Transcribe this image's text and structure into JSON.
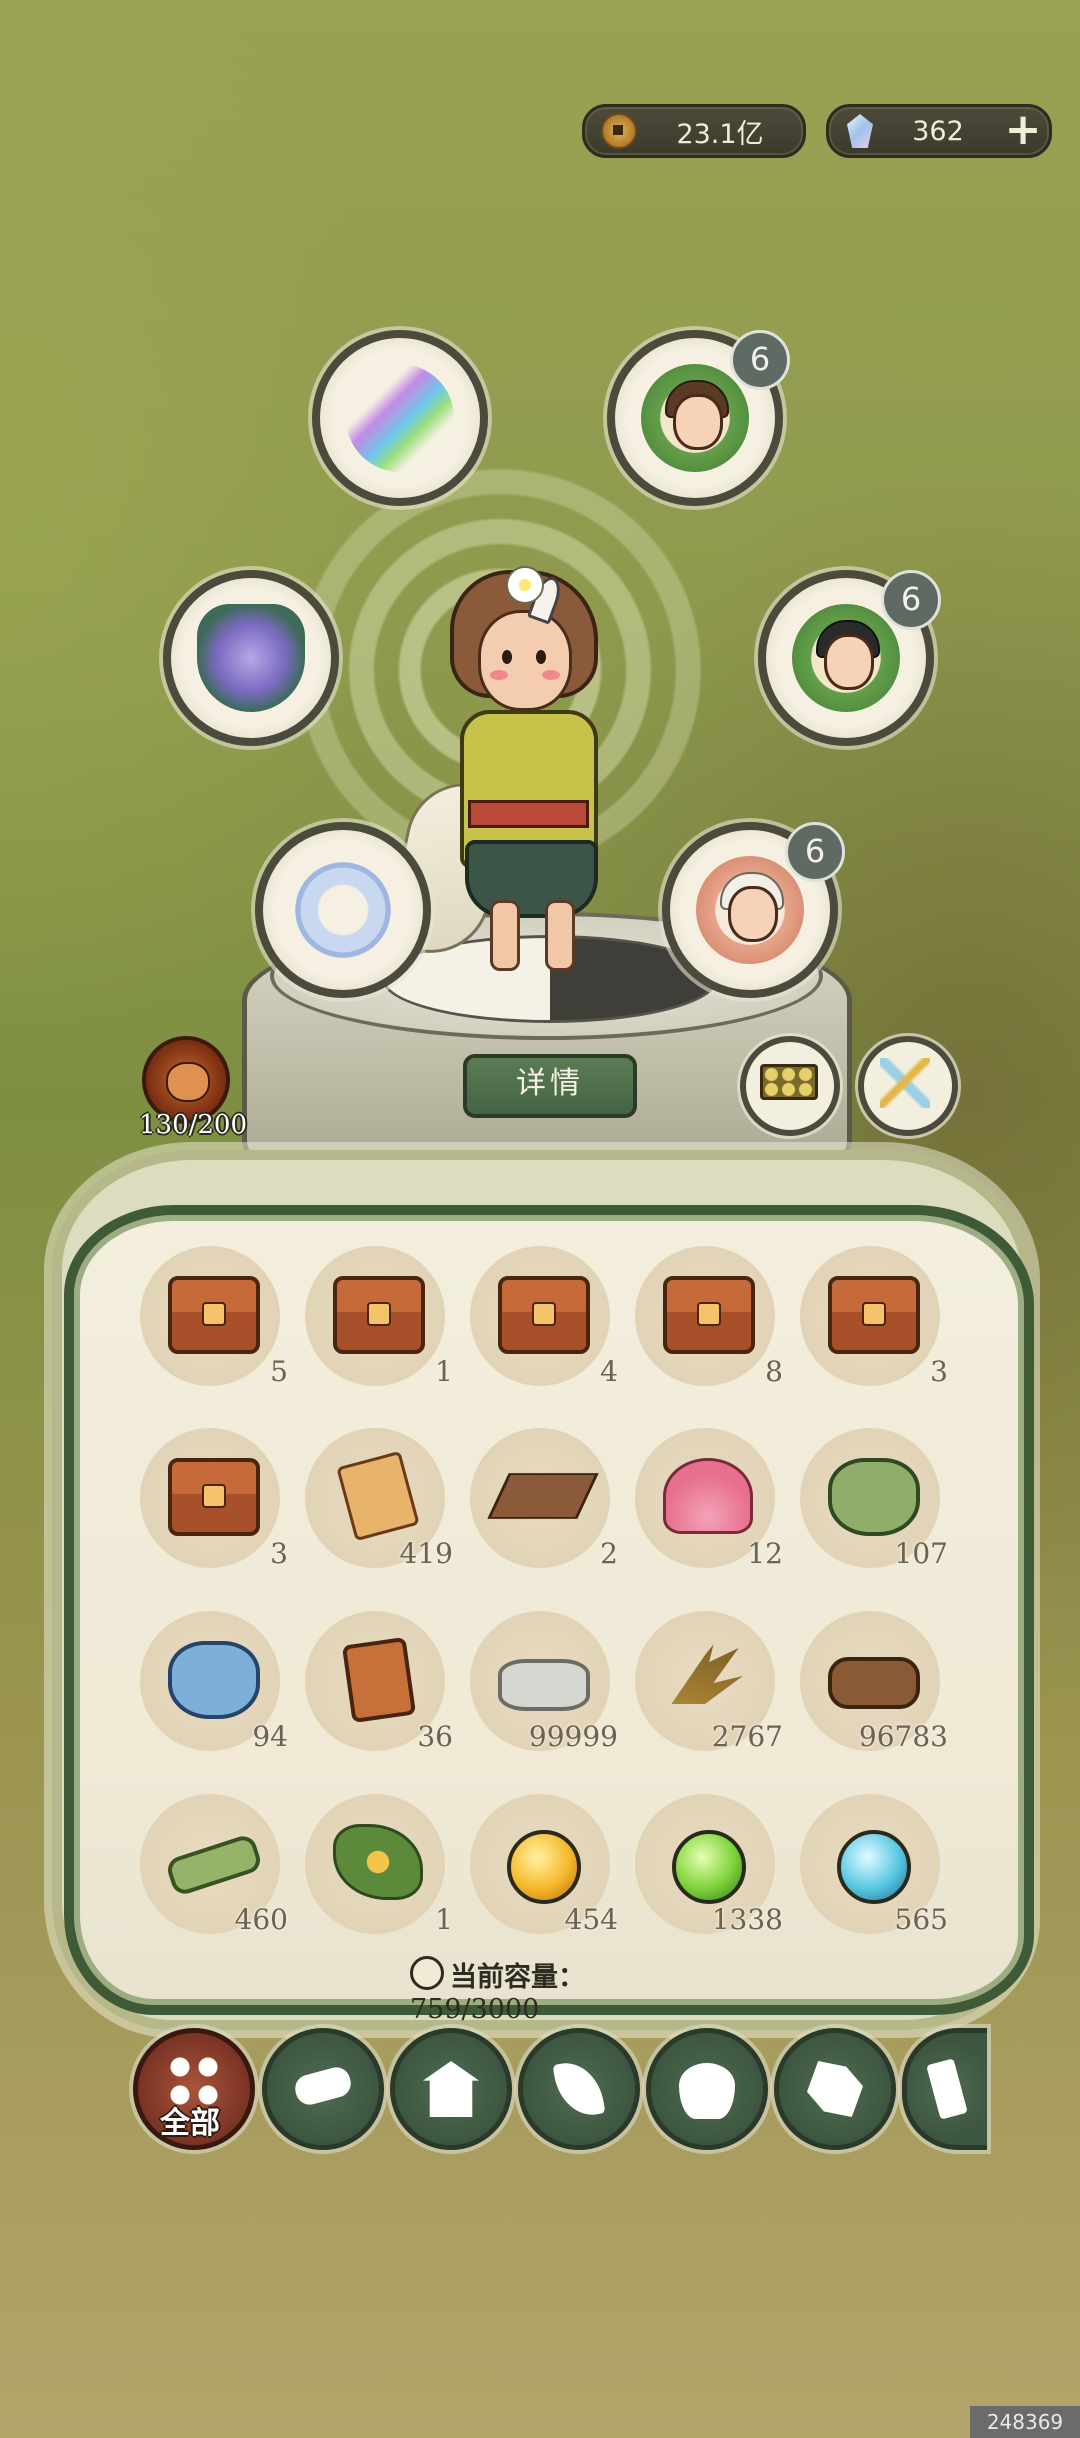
{
  "currency": {
    "coins": "23.1亿",
    "gems": "362",
    "coin_icon": "copper-coin-icon",
    "gem_icon": "crystal-gem-icon",
    "add_icon": "plus-icon"
  },
  "hero": {
    "detail_button": "详情",
    "stamina_text": "130/200",
    "companions": [
      {
        "name": "companion-portrait-1",
        "level": "6"
      },
      {
        "name": "companion-portrait-2",
        "level": "6"
      },
      {
        "name": "companion-portrait-3",
        "level": "6"
      }
    ],
    "equipment": [
      "spirit-blade-icon",
      "demon-mask-icon",
      "jade-ring-icon"
    ],
    "extras": [
      "abacus-icon",
      "feather-fan-icon"
    ]
  },
  "inventory": {
    "capacity_label": "当前容量：",
    "capacity_value": "759/3000",
    "items": [
      {
        "icon": "treasure-chest-icon",
        "count": "5"
      },
      {
        "icon": "treasure-chest-icon",
        "count": "1"
      },
      {
        "icon": "treasure-chest-icon",
        "count": "4"
      },
      {
        "icon": "treasure-chest-icon",
        "count": "8"
      },
      {
        "icon": "treasure-chest-icon",
        "count": "3"
      },
      {
        "icon": "treasure-chest-icon",
        "count": "3"
      },
      {
        "icon": "scroll-icon",
        "count": "419"
      },
      {
        "icon": "wooden-board-icon",
        "count": "2"
      },
      {
        "icon": "lotus-icon",
        "count": "12"
      },
      {
        "icon": "green-pouch-icon",
        "count": "107"
      },
      {
        "icon": "blue-pouch-icon",
        "count": "94"
      },
      {
        "icon": "token-plaque-icon",
        "count": "36"
      },
      {
        "icon": "stone-icon",
        "count": "99999"
      },
      {
        "icon": "grass-bundle-icon",
        "count": "2767"
      },
      {
        "icon": "wood-log-icon",
        "count": "96783"
      },
      {
        "icon": "bamboo-icon",
        "count": "460"
      },
      {
        "icon": "herb-icon",
        "count": "1"
      },
      {
        "icon": "gold-orb-icon",
        "count": "454"
      },
      {
        "icon": "green-orb-icon",
        "count": "1338"
      },
      {
        "icon": "blue-orb-icon",
        "count": "565"
      }
    ]
  },
  "tabs": {
    "all_label": "全部",
    "icons": [
      "all-grid-icon",
      "wood-icon",
      "building-icon",
      "leaf-icon",
      "food-bowl-icon",
      "map-fragment-icon",
      "scroll-tab-icon"
    ]
  },
  "watermark": "248369"
}
